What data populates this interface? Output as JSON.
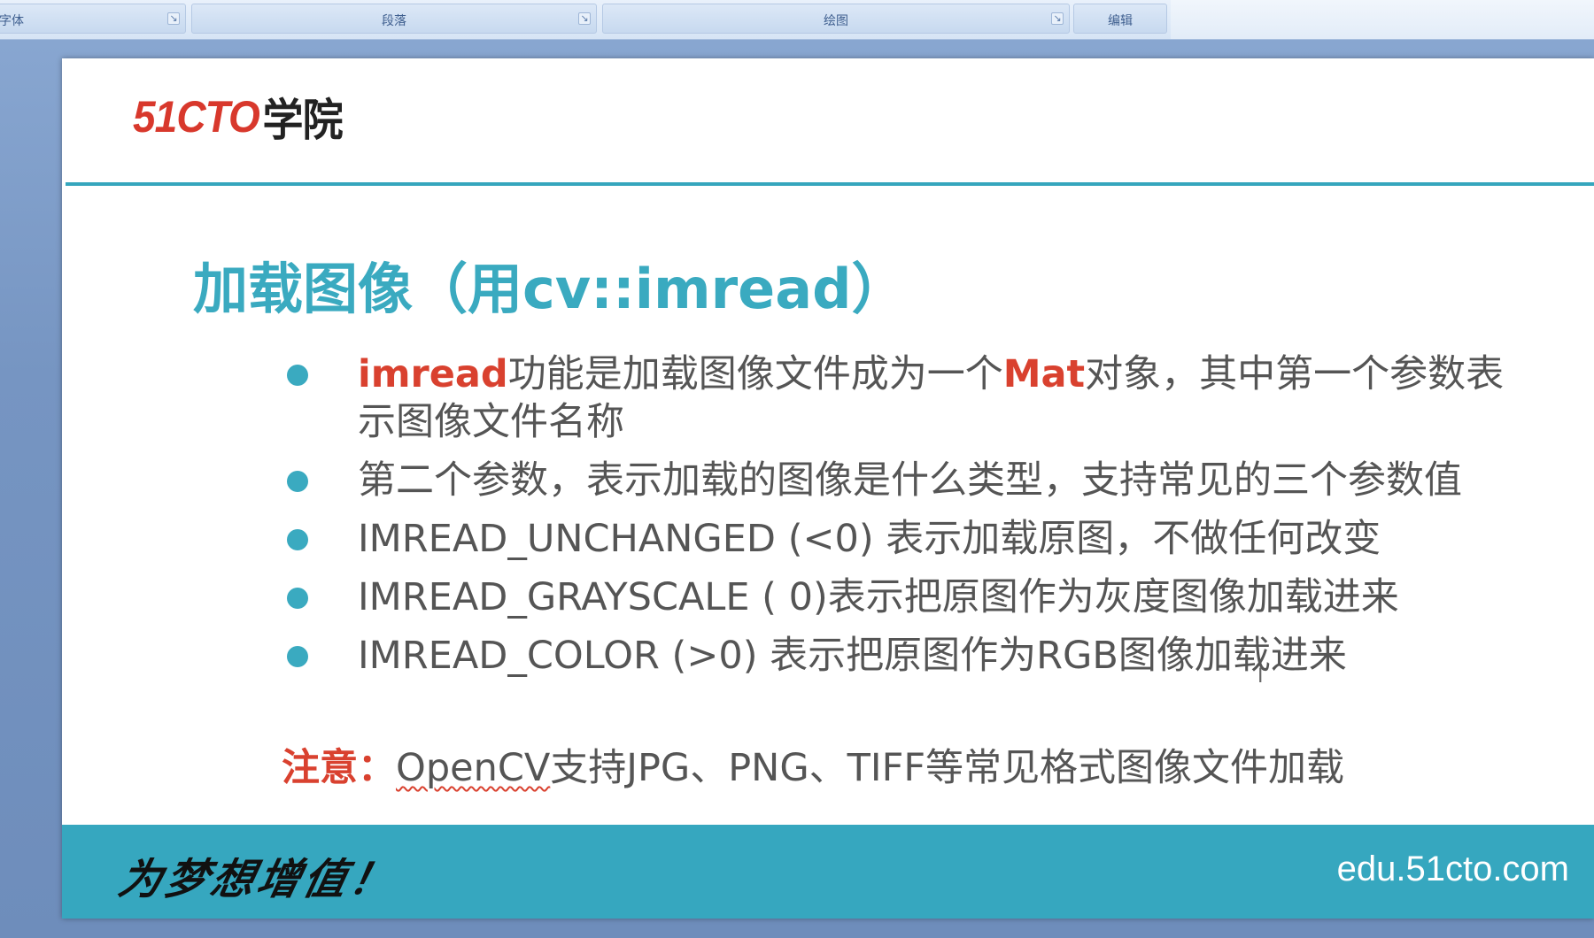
{
  "ribbon": {
    "groups": [
      {
        "label": "字体"
      },
      {
        "label": "段落"
      },
      {
        "label": "绘图"
      },
      {
        "label": "编辑"
      }
    ],
    "launcher_icon": "dialog-launcher-icon"
  },
  "slide": {
    "logo": {
      "brand": "51CTO",
      "school": "学院"
    },
    "title": "加载图像（用cv::imread）",
    "bullets": [
      {
        "lead": "imread",
        "text_a": "功能是加载图像文件成为一个",
        "mid": "Mat",
        "text_b": "对象，其中第一个参数表示图像文件名称"
      },
      {
        "text": "第二个参数，表示加载的图像是什么类型，支持常见的三个参数值"
      },
      {
        "text": "IMREAD_UNCHANGED (<0) 表示加载原图，不做任何改变"
      },
      {
        "text": "IMREAD_GRAYSCALE ( 0)表示把原图作为灰度图像加载进来"
      },
      {
        "text": "IMREAD_COLOR (>0) 表示把原图作为RGB图像加载进来"
      }
    ],
    "note": {
      "label": "注意：",
      "underlined": "OpenCV",
      "rest": "支持JPG、PNG、TIFF等常见格式图像文件加载"
    },
    "footer": {
      "slogan": "为梦想增值！",
      "url": "edu.51cto.com"
    },
    "bullet_color": "#3aaac0",
    "accent_red": "#d9412f"
  }
}
